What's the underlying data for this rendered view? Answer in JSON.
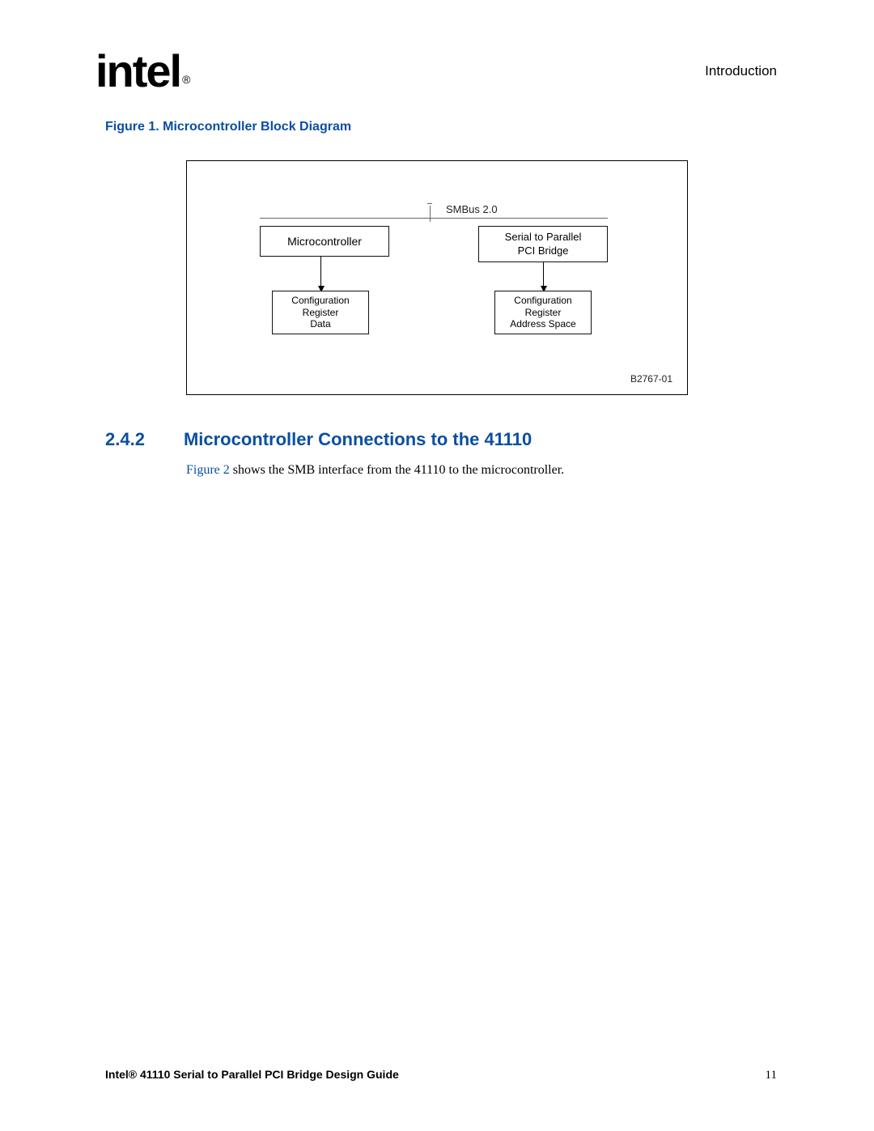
{
  "header": {
    "logo_text": "intel",
    "logo_reg": "®",
    "section_name": "Introduction"
  },
  "figure1": {
    "caption": "Figure 1.  Microcontroller Block Diagram",
    "bus_label": "SMBus 2.0",
    "box_microcontroller": "Microcontroller",
    "box_serial_parallel_line1": "Serial to Parallel",
    "box_serial_parallel_line2": "PCI Bridge",
    "box_cfg_reg_data_line1": "Configuration",
    "box_cfg_reg_data_line2": "Register",
    "box_cfg_reg_data_line3": "Data",
    "box_cfg_reg_addr_line1": "Configuration",
    "box_cfg_reg_addr_line2": "Register",
    "box_cfg_reg_addr_line3": "Address Space",
    "code": "B2767-01"
  },
  "section": {
    "number": "2.4.2",
    "title": "Microcontroller Connections to the 41110",
    "body_ref": "Figure 2",
    "body_rest": " shows the SMB interface from the 41110 to the microcontroller."
  },
  "footer": {
    "title": "Intel® 41110 Serial to Parallel PCI Bridge Design Guide",
    "page": "11"
  }
}
